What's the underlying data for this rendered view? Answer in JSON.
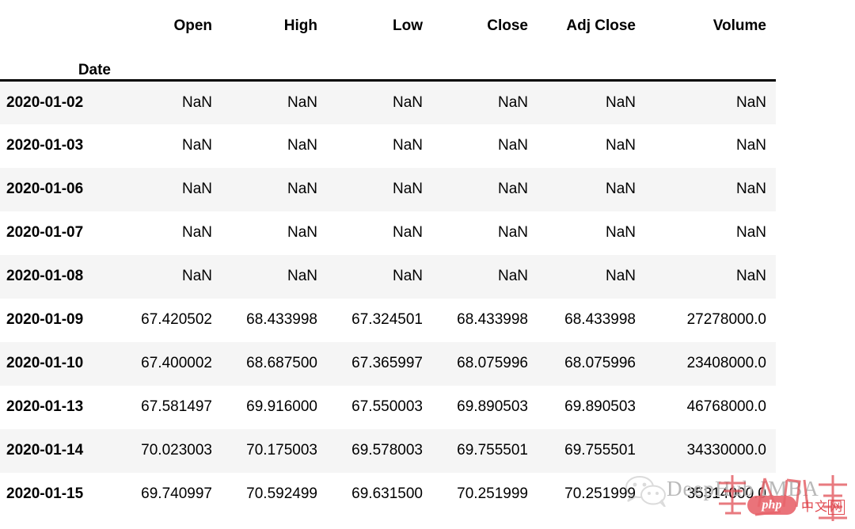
{
  "table": {
    "index_name": "Date",
    "columns": [
      "Open",
      "High",
      "Low",
      "Close",
      "Adj Close",
      "Volume"
    ],
    "rows": [
      {
        "date": "2020-01-02",
        "cells": [
          "NaN",
          "NaN",
          "NaN",
          "NaN",
          "NaN",
          "NaN"
        ]
      },
      {
        "date": "2020-01-03",
        "cells": [
          "NaN",
          "NaN",
          "NaN",
          "NaN",
          "NaN",
          "NaN"
        ]
      },
      {
        "date": "2020-01-06",
        "cells": [
          "NaN",
          "NaN",
          "NaN",
          "NaN",
          "NaN",
          "NaN"
        ]
      },
      {
        "date": "2020-01-07",
        "cells": [
          "NaN",
          "NaN",
          "NaN",
          "NaN",
          "NaN",
          "NaN"
        ]
      },
      {
        "date": "2020-01-08",
        "cells": [
          "NaN",
          "NaN",
          "NaN",
          "NaN",
          "NaN",
          "NaN"
        ]
      },
      {
        "date": "2020-01-09",
        "cells": [
          "67.420502",
          "68.433998",
          "67.324501",
          "68.433998",
          "68.433998",
          "27278000.0"
        ]
      },
      {
        "date": "2020-01-10",
        "cells": [
          "67.400002",
          "68.687500",
          "67.365997",
          "68.075996",
          "68.075996",
          "23408000.0"
        ]
      },
      {
        "date": "2020-01-13",
        "cells": [
          "67.581497",
          "69.916000",
          "67.550003",
          "69.890503",
          "69.890503",
          "46768000.0"
        ]
      },
      {
        "date": "2020-01-14",
        "cells": [
          "70.023003",
          "70.175003",
          "69.578003",
          "69.755501",
          "69.755501",
          "34330000.0"
        ]
      },
      {
        "date": "2020-01-15",
        "cells": [
          "69.740997",
          "70.592499",
          "69.631500",
          "70.251999",
          "70.251999",
          "35314000.0"
        ]
      }
    ]
  },
  "watermark": {
    "brand": "DeepHub IMBA",
    "php_badge": "php",
    "cn_text_1": "中文",
    "cn_text_2": "网",
    "brand_color": "#b9b9b9",
    "seal_color": "#e0484f"
  }
}
